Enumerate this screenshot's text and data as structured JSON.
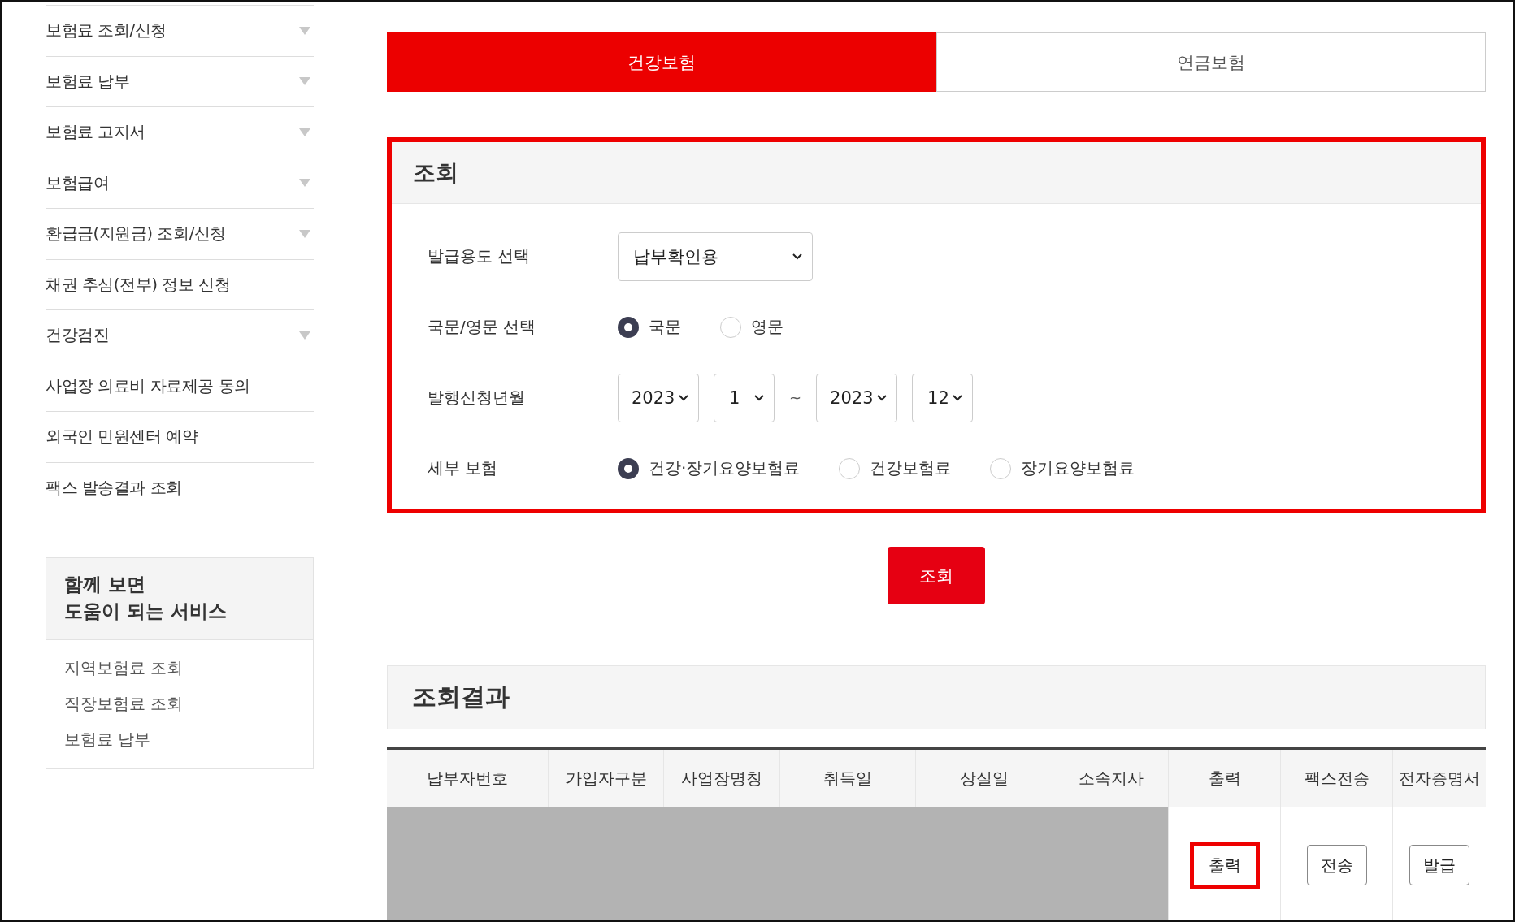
{
  "sidebar": {
    "menu": [
      {
        "label": "보험료 조회/신청",
        "kind": "submenu"
      },
      {
        "label": "보험료 납부",
        "kind": "submenu"
      },
      {
        "label": "보험료 고지서",
        "kind": "submenu"
      },
      {
        "label": "보험급여",
        "kind": "submenu"
      },
      {
        "label": "환급금(지원금) 조회/신청",
        "kind": "submenu"
      },
      {
        "label": "채권 추심(전부) 정보 신청",
        "kind": "link"
      },
      {
        "label": "건강검진",
        "kind": "submenu"
      },
      {
        "label": "사업장 의료비 자료제공 동의",
        "kind": "link"
      },
      {
        "label": "외국인 민원센터 예약",
        "kind": "link"
      },
      {
        "label": "팩스 발송결과 조회",
        "kind": "link"
      }
    ],
    "related": {
      "title_lines": [
        "함께 보면",
        "도움이 되는 서비스"
      ],
      "links": [
        "지역보험료 조회",
        "직장보험료 조회",
        "보험료 납부"
      ]
    }
  },
  "tabs": [
    {
      "label": "건강보험",
      "selected": true
    },
    {
      "label": "연금보험",
      "selected": false
    }
  ],
  "search_form": {
    "title": "조회",
    "highlighted": true,
    "purpose": {
      "label": "발급용도 선택",
      "value": "납부확인용"
    },
    "language": {
      "label": "국문/영문 선택",
      "options": [
        {
          "label": "국문",
          "selected": true
        },
        {
          "label": "영문",
          "selected": false
        }
      ]
    },
    "period": {
      "label": "발행신청년월",
      "from_year": "2023",
      "from_month": "1",
      "separator": "~",
      "to_year": "2023",
      "to_month": "12"
    },
    "insurance_type": {
      "label": "세부 보험",
      "options": [
        {
          "label": "건강·장기요양보험료",
          "selected": true
        },
        {
          "label": "건강보험료",
          "selected": false
        },
        {
          "label": "장기요양보험료",
          "selected": false
        }
      ]
    }
  },
  "search_button": "조회",
  "results": {
    "title": "조회결과",
    "columns": [
      "납부자번호",
      "가입자구분",
      "사업장명칭",
      "취득일",
      "상실일",
      "소속지사",
      "출력",
      "팩스전송",
      "전자증명서"
    ],
    "rows": [
      {
        "redacted": true,
        "actions": [
          {
            "label": "출력",
            "highlighted": true
          },
          {
            "label": "전송",
            "highlighted": false
          },
          {
            "label": "발급",
            "highlighted": false
          }
        ]
      }
    ]
  }
}
